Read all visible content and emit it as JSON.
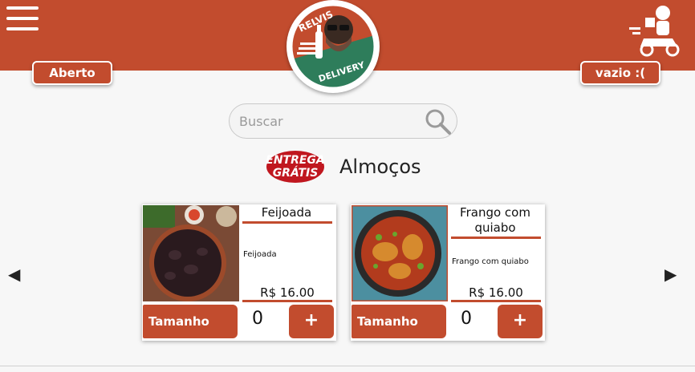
{
  "header": {
    "menu_icon": "hamburger-menu-icon",
    "logo_text_top": "RELVIS",
    "logo_text_bottom": "DELIVERY",
    "delivery_icon": "delivery-scooter-icon",
    "status_label": "Aberto",
    "cart_label": "vazio :(",
    "brand_color": "#c24c2e",
    "logo_green": "#2e7d5b"
  },
  "search": {
    "placeholder": "Buscar",
    "icon": "search-icon"
  },
  "section": {
    "badge_line1": "ENTREGA",
    "badge_line2": "GRÁTIS",
    "title": "Almoços"
  },
  "carousel": {
    "prev_icon": "◀",
    "next_icon": "▶",
    "products": [
      {
        "name": "Feijoada",
        "description": "Feijoada",
        "price": "R$ 16.00",
        "size_label": "Tamanho",
        "quantity": "0",
        "add_label": "+"
      },
      {
        "name": "Frango com quiabo",
        "description": "Frango com quiabo",
        "price": "R$ 16.00",
        "size_label": "Tamanho",
        "quantity": "0",
        "add_label": "+"
      }
    ]
  }
}
